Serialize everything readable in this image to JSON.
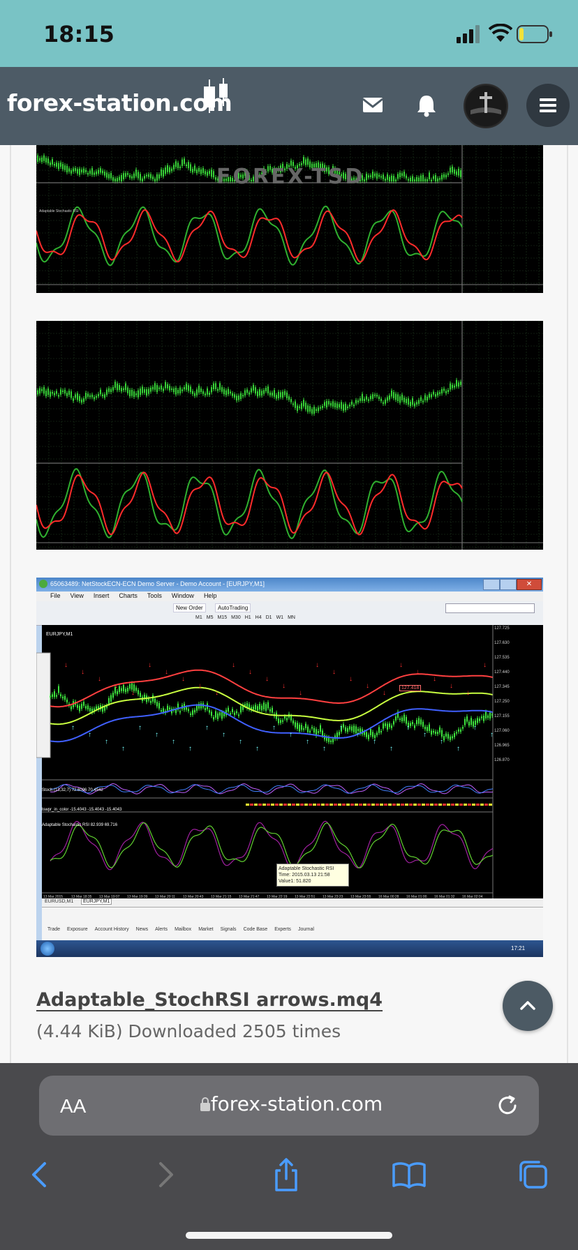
{
  "status_bar": {
    "time": "18:15"
  },
  "site_header": {
    "logo_text": "forex-station.com"
  },
  "charts": {
    "chart1_indicator_label": "Adaptable Stochastic RSI",
    "chart1_watermark": "FOREX-TSD",
    "chart3": {
      "window_title": "65063489: NetStockECN-ECN Demo Server - Demo Account - [EURJPY,M1]",
      "menu": [
        "File",
        "View",
        "Insert",
        "Charts",
        "Tools",
        "Window",
        "Help"
      ],
      "toolbar_new_order": "New Order",
      "toolbar_autotrading": "AutoTrading",
      "timeframes": [
        "M1",
        "M5",
        "M15",
        "M30",
        "H1",
        "H4",
        "D1",
        "W1",
        "MN"
      ],
      "symbol_label": "EURJPY,M1",
      "price_marker": "127.418",
      "stoch_label": "Stoch (13,32,7) 72.6096 70.4542",
      "lswpr_label": "lswpr_in_color -15.4043 -15.4043 -15.4043",
      "asrsi_label": "Adaptable Stochastic RSI 82.939 69.716",
      "tooltip": [
        "Adaptable Stochastic RSI",
        "Time: 2015.03.13 21:58",
        "Value1: 51.820"
      ],
      "sheet_tabs": [
        "EURUSD,M1",
        "EURJPY,M1"
      ],
      "terminal_tabs": [
        "Trade",
        "Exposure",
        "Account History",
        "News",
        "Alerts",
        "Mailbox",
        "Market",
        "Signals",
        "Code Base",
        "Experts",
        "Journal"
      ],
      "taskbar_clock": "17:21",
      "price_axis": [
        "127.725",
        "127.630",
        "127.535",
        "127.440",
        "127.345",
        "127.250",
        "127.155",
        "127.060",
        "126.965",
        "126.870"
      ],
      "time_axis": [
        "13 Mar 2015",
        "13 Mar 18:35",
        "13 Mar 19:07",
        "13 Mar 19:39",
        "13 Mar 20:11",
        "13 Mar 20:43",
        "13 Mar 21:15",
        "13 Mar 21:47",
        "13 Mar 22:19",
        "13 Mar 22:51",
        "13 Mar 23:23",
        "13 Mar 23:55",
        "16 Mar 00:28",
        "16 Mar 01:00",
        "16 Mar 01:32",
        "16 Mar 02:04"
      ]
    }
  },
  "download": {
    "filename": "Adaptable_StochRSI arrows.mq4",
    "meta": "(4.44 KiB) Downloaded 2505 times"
  },
  "browser": {
    "aa_label": "AA",
    "url": "forex-station.com"
  },
  "colors": {
    "status_bar": "#79c3c5",
    "header": "#4d5b66",
    "candles": "#33cc33",
    "signal_line": "#ff3333",
    "browser_bar": "#4a4a4d"
  }
}
